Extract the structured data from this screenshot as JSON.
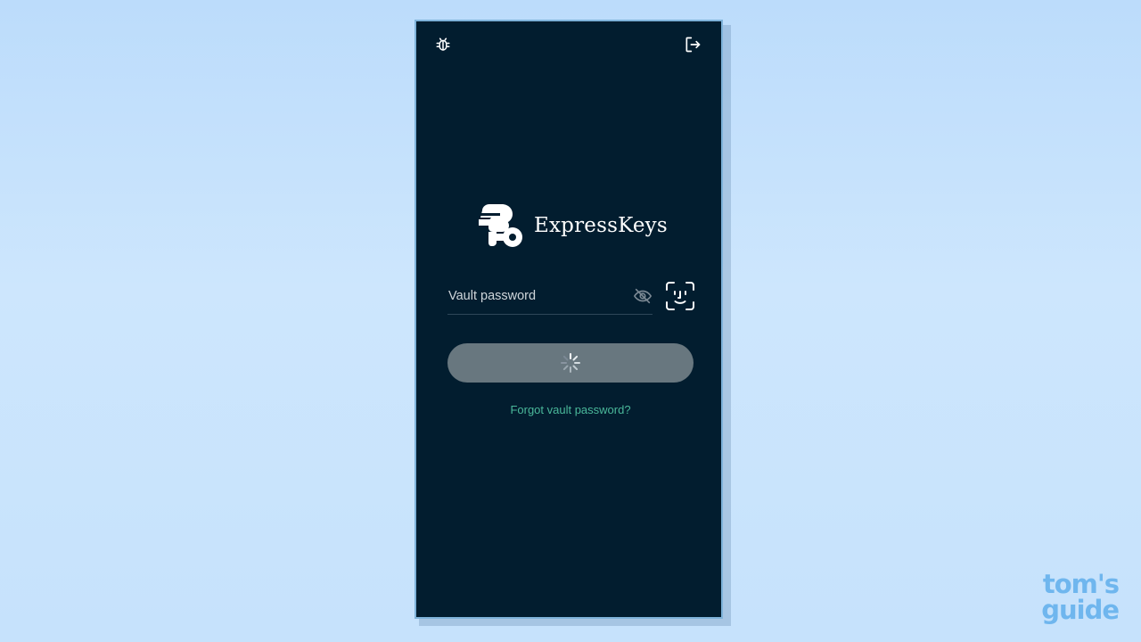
{
  "app": {
    "name": "ExpressKeys"
  },
  "icons": {
    "top_left": "bug-icon",
    "top_right": "logout-icon",
    "password_toggle": "eye-off-icon",
    "biometric": "face-id-icon",
    "button": "loading-spinner-icon"
  },
  "login": {
    "password_placeholder": "Vault password",
    "password_value": "",
    "forgot_link": "Forgot vault password?"
  },
  "colors": {
    "background": "#021d2f",
    "button": "#68777f",
    "link": "#4ab89a"
  },
  "watermark": {
    "line1": "tom's",
    "line2": "guide"
  }
}
